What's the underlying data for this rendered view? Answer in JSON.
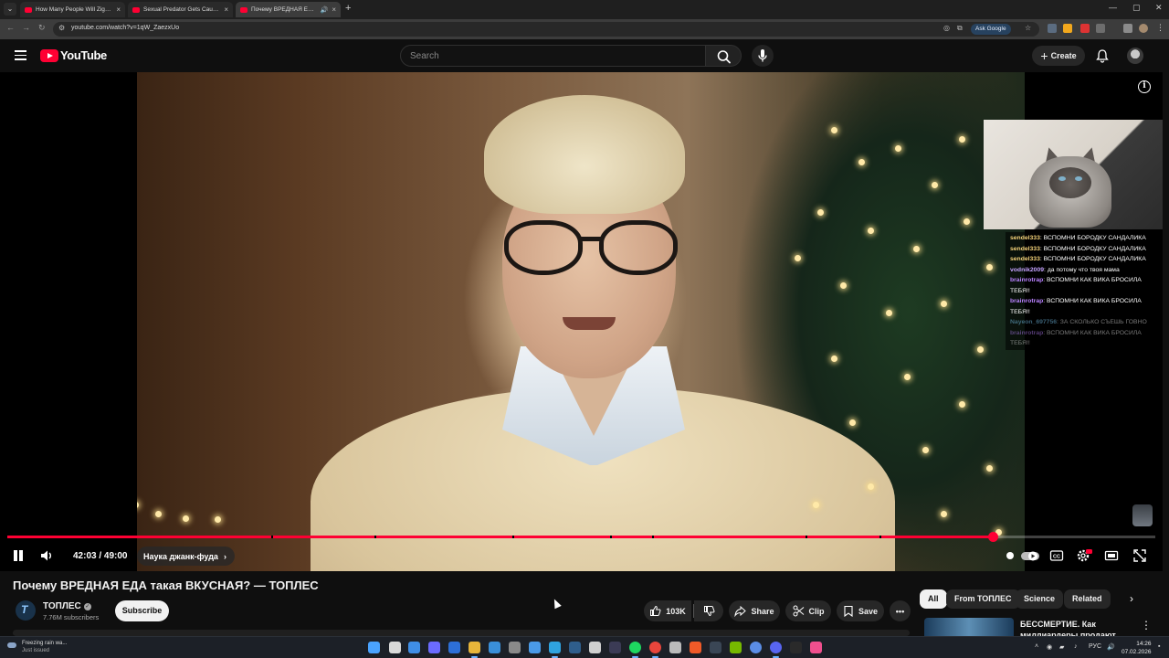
{
  "browser": {
    "tabs": [
      {
        "title": "How Many People Will Zigant Have",
        "active": false
      },
      {
        "title": "Sexual Predator Gets Caught in",
        "active": false
      },
      {
        "title": "Почему ВРЕДНАЯ ЕДА так",
        "active": true
      }
    ],
    "url": "youtube.com/watch?v=1qW_ZaezxUo",
    "ask_google_label": "Ask Google"
  },
  "youtube": {
    "logo_text": "YouTube",
    "search_placeholder": "Search",
    "create_label": "Create"
  },
  "chat": [
    {
      "user": "sendel333",
      "color": "#f5d37a",
      "text": "ВСПОМНИ БОРОДКУ САНДАЛИКА",
      "dim": false
    },
    {
      "user": "sendel333",
      "color": "#f5d37a",
      "text": "ВСПОМНИ БОРОДКУ САНДАЛИКА",
      "dim": false
    },
    {
      "user": "sendel333",
      "color": "#f5d37a",
      "text": "ВСПОМНИ БОРОДКУ САНДАЛИКА",
      "dim": false
    },
    {
      "user": "vodnik2009",
      "color": "#c5a3ff",
      "text": "да потому что твоя мама",
      "dim": false
    },
    {
      "user": "brainrotrap",
      "color": "#b982ff",
      "text": "ВСПОМНИ КАК ВИКА БРОСИЛА ТЕБЯ!!",
      "dim": false
    },
    {
      "user": "brainrotrap",
      "color": "#b982ff",
      "text": "ВСПОМНИ КАК ВИКА БРОСИЛА ТЕБЯ!!",
      "dim": false
    },
    {
      "user": "Nayeon_697756",
      "color": "#7fd1ff",
      "text": "ЗА СКОЛЬКО СЪЕШЬ ГОВНО",
      "dim": true
    },
    {
      "user": "brainrotrap",
      "color": "#b982ff",
      "text": "ВСПОМНИ КАК ВИКА БРОСИЛА ТЕБЯ!!",
      "dim": true
    }
  ],
  "player": {
    "time_current": "42:03",
    "time_total": "49:00",
    "time_display": "42:03 / 49:00",
    "progress_fraction": 0.858,
    "chapter_fractions": [
      0.23,
      0.32,
      0.44,
      0.525,
      0.562,
      0.695,
      0.76
    ],
    "chapter_label": "Наука джанк-фуда",
    "accent_color": "#ff0033"
  },
  "video": {
    "title": "Почему ВРЕДНАЯ ЕДА такая ВКУСНАЯ? — ТОПЛЕС",
    "channel_name": "ТОПЛЕС",
    "subscribers": "7.76M subscribers",
    "subscribe_label": "Subscribe",
    "likes": "103K",
    "share_label": "Share",
    "clip_label": "Clip",
    "save_label": "Save"
  },
  "recommendations": {
    "chips": [
      "All",
      "From ТОПЛЕС",
      "Science",
      "Related"
    ],
    "active_chip": "All",
    "first_title": "БЕССМЕРТИЕ. Как миллиардеры продают"
  },
  "taskbar": {
    "weather_title": "Freezing rain wa...",
    "weather_sub": "Just issued",
    "language": "РУС",
    "time": "14:26",
    "date": "07.02.2026"
  }
}
